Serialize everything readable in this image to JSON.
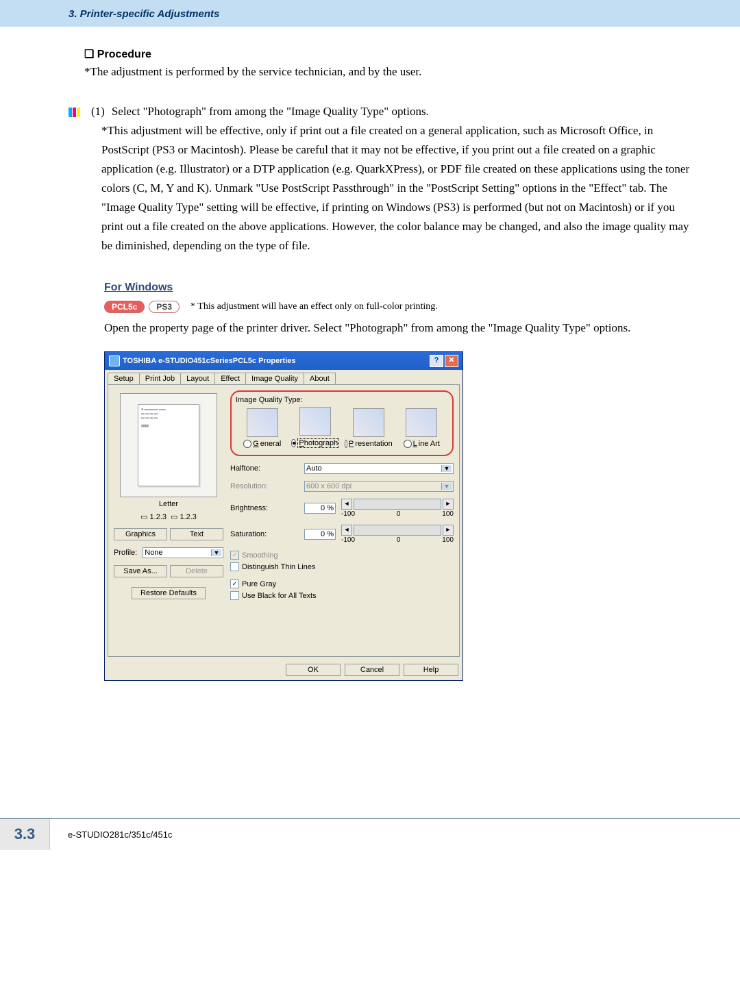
{
  "header": {
    "section_title": "3. Printer-specific Adjustments"
  },
  "procedure": {
    "heading": "Procedure",
    "note": "*The adjustment is performed by the service technician, and by the user.",
    "step_number": "(1)",
    "step_title": "Select \"Photograph\" from among the \"Image Quality Type\" options.",
    "step_body": "*This adjustment will be effective, only if print out a file created on a general application, such as Microsoft Office, in PostScript (PS3 or Macintosh).  Please be careful that it may not be effective, if you print out a file created on a graphic application (e.g. Illustrator) or a DTP application (e.g. QuarkXPress), or PDF file created on these applications using the toner colors (C, M, Y and K).  Unmark \"Use PostScript Passthrough\" in the \"PostScript Setting\" options in the \"Effect\" tab.  The \"Image Quality Type\" setting will be effective, if printing on Windows (PS3) is performed (but not on Macintosh) or if you print out a file created on the above applications.  However, the color balance may be changed, and also the image quality may be diminished, depending on the type of file."
  },
  "windows": {
    "heading": "For Windows",
    "badges": {
      "pcl": "PCL5c",
      "ps": "PS3"
    },
    "badge_note": "* This adjustment will have an effect only on full-color printing.",
    "open_prop": "Open the property page of the printer driver.  Select \"Photograph\" from among the \"Image Quality Type\" options."
  },
  "dialog": {
    "title": "TOSHIBA e-STUDIO451cSeriesPCL5c Properties",
    "tabs": [
      "Setup",
      "Print Job",
      "Layout",
      "Effect",
      "Image Quality",
      "About"
    ],
    "active_tab": "Image Quality",
    "iqt_label": "Image Quality Type:",
    "iqt_options": [
      "General",
      "Photograph",
      "Presentation",
      "Line Art"
    ],
    "iqt_selected": "Photograph",
    "halftone": {
      "label": "Halftone:",
      "value": "Auto"
    },
    "resolution": {
      "label": "Resolution:",
      "value": "600 x 600 dpi"
    },
    "brightness": {
      "label": "Brightness:",
      "value": "0 %",
      "min": "-100",
      "mid": "0",
      "max": "100"
    },
    "saturation": {
      "label": "Saturation:",
      "value": "0 %",
      "min": "-100",
      "mid": "0",
      "max": "100"
    },
    "smoothing": "Smoothing",
    "thin_lines": "Distinguish Thin Lines",
    "pure_gray": "Pure Gray",
    "black_texts": "Use Black for All Texts",
    "letter": "Letter",
    "size1": "1.2.3",
    "size2": "1.2.3",
    "graphics": "Graphics",
    "text": "Text",
    "profile_label": "Profile:",
    "profile_value": "None",
    "save_as": "Save As...",
    "delete": "Delete",
    "restore": "Restore Defaults",
    "ok": "OK",
    "cancel": "Cancel",
    "help": "Help"
  },
  "footer": {
    "num": "3.3",
    "model": "e-STUDIO281c/351c/451c"
  }
}
